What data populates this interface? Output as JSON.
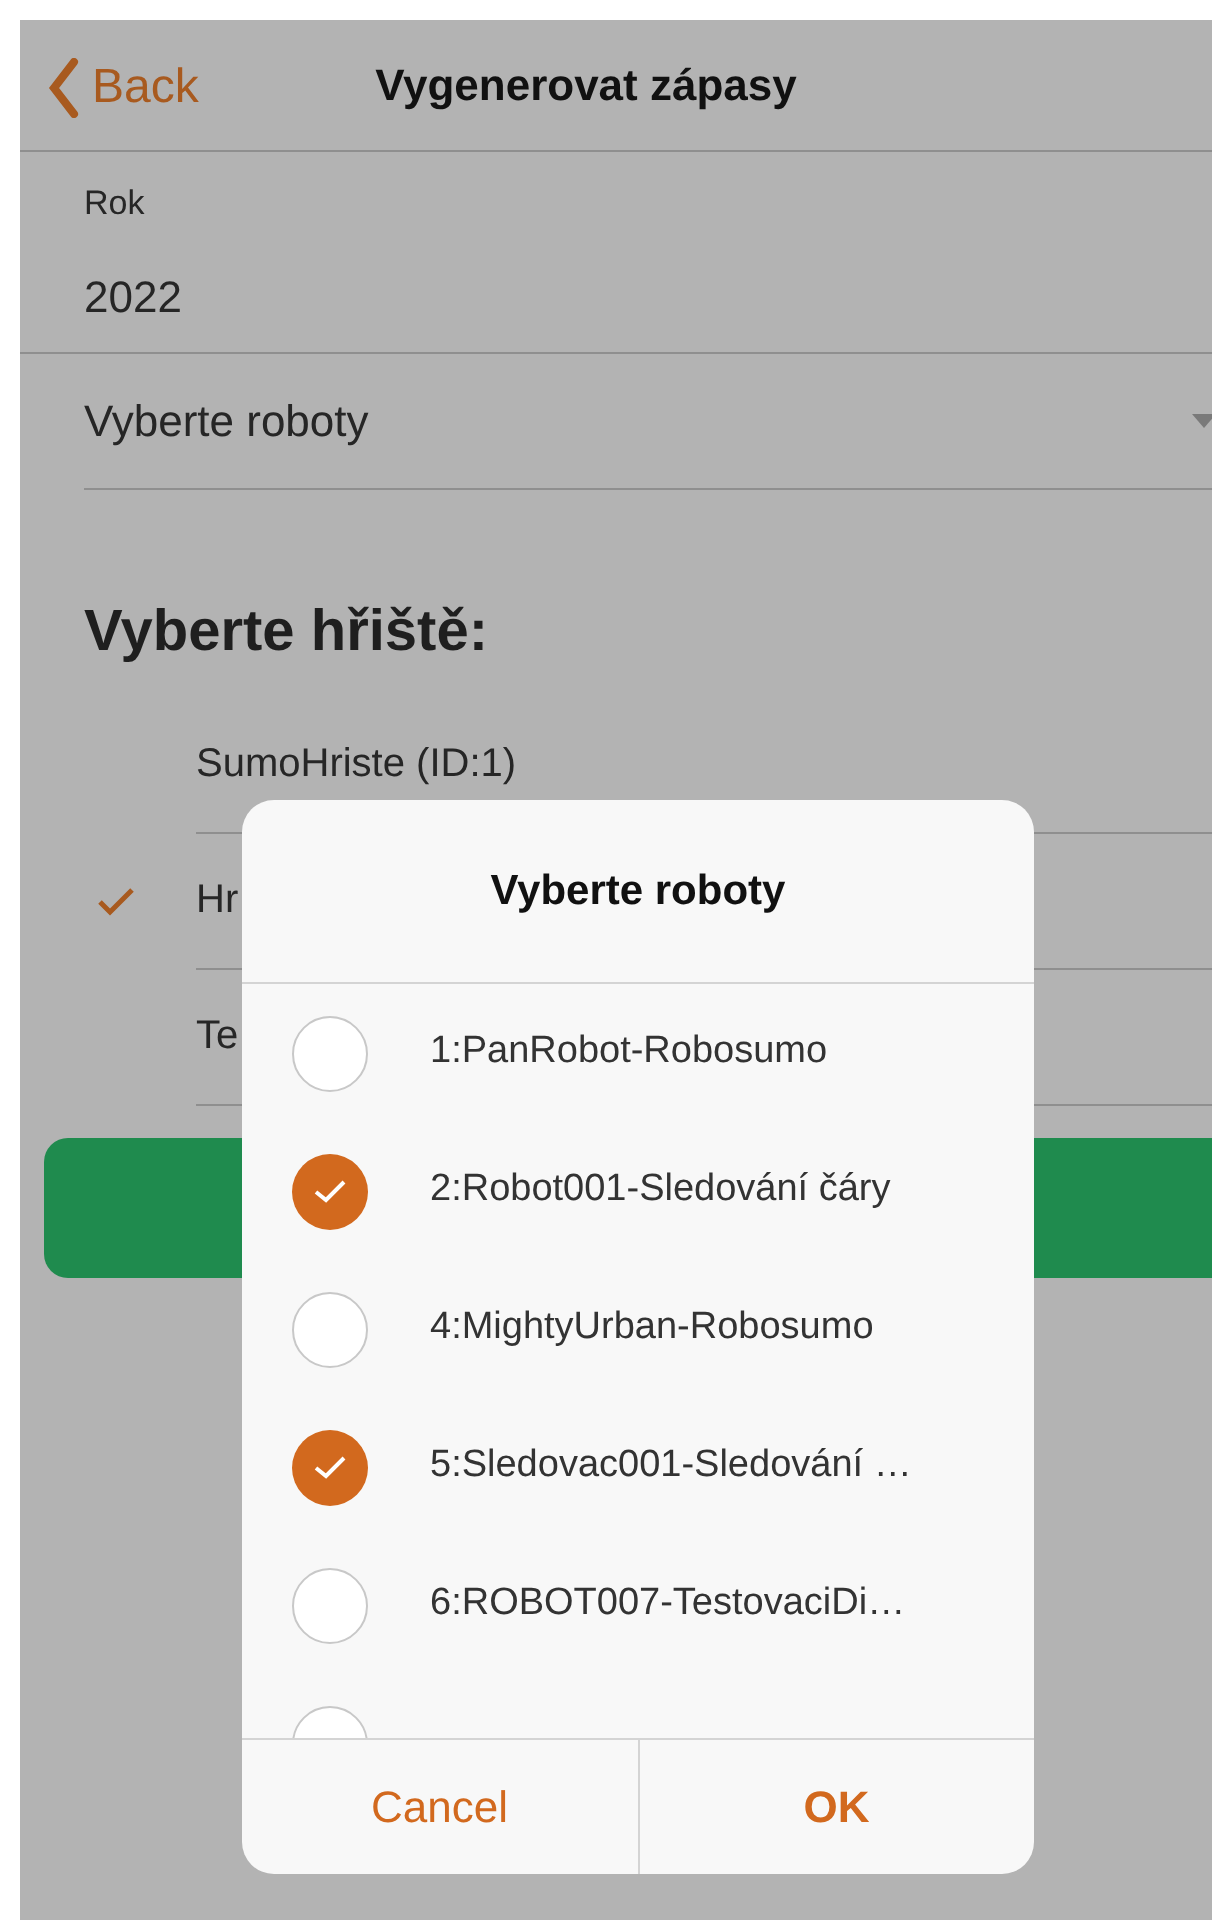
{
  "header": {
    "back": "Back",
    "title": "Vygenerovat zápasy"
  },
  "year": {
    "label": "Rok",
    "value": "2022"
  },
  "robot_select": {
    "placeholder": "Vyberte roboty"
  },
  "fields_heading": "Vyberte hřiště:",
  "fields": [
    {
      "label": "SumoHriste (ID:1)",
      "checked": false
    },
    {
      "label": "Hr",
      "checked": true
    },
    {
      "label": "Te",
      "checked": false
    }
  ],
  "dialog": {
    "title": "Vyberte roboty",
    "robots": [
      {
        "label": "1:PanRobot-Robosumo",
        "selected": false
      },
      {
        "label": "2:Robot001-Sledování čáry",
        "selected": true
      },
      {
        "label": "4:MightyUrban-Robosumo",
        "selected": false
      },
      {
        "label": "5:Sledovac001-Sledování …",
        "selected": true
      },
      {
        "label": "6:ROBOT007-TestovaciDi…",
        "selected": false
      },
      {
        "selected": false
      }
    ],
    "buttons": [
      {
        "label": "Cancel",
        "kind": "cancel"
      },
      {
        "label": "OK",
        "kind": "ok"
      }
    ]
  }
}
